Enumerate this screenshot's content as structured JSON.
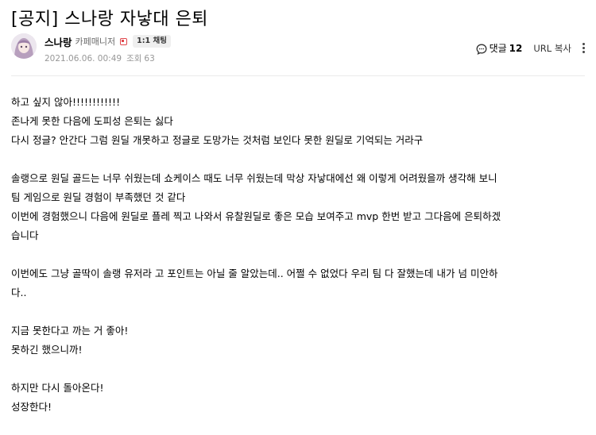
{
  "post": {
    "title": "[공지] 스나랑 자낳대 은퇴",
    "author": {
      "nickname": "스나랑",
      "role": "카페매니저",
      "chat_label": "1:1 채팅"
    },
    "date": "2021.06.06. 00:49",
    "views_label": "조회",
    "views": "63"
  },
  "tools": {
    "comment_label": "댓글",
    "comment_count": "12",
    "url_copy_label": "URL 복사",
    "icons": [
      "comment-icon",
      "more-icon"
    ]
  },
  "body": {
    "lines": [
      "하고 싶지 않아!!!!!!!!!!!!",
      "존나게 못한 다음에 도피성 은퇴는 싫다",
      "다시 정글? 안간다 그럼 원딜 개못하고 정글로 도망가는 것처럼 보인다 못한 원딜로 기억되는 거라구",
      "",
      "솔랭으로 원딜 골드는 너무 쉬웠는데 쇼케이스 때도 너무 쉬웠는데 막상 자낳대에선 왜 이렇게 어려웠을까 생각해 보니",
      "팀 게임으로 원딜 경험이 부족했던 것 같다",
      "이번에 경험했으니 다음에 원딜로 플레 찍고 나와서 유찰원딜로 좋은 모습 보여주고 mvp 한번 받고 그다음에 은퇴하겠",
      "습니다",
      "",
      "이번에도 그냥 골딱이 솔랭 유저라 고 포인트는 아닐 줄 알았는데.. 어쩔 수 없었다 우리 팀 다 잘했는데 내가 넘 미안하",
      "다..",
      "",
      "지금 못한다고 까는 거 좋아!",
      "못하긴 했으니까!",
      "",
      "하지만 다시 돌아온다!",
      "성장한다!"
    ]
  },
  "colors": {
    "meta_text": "#979797",
    "grade_badge": "#e0464b",
    "divider": "#ebebeb"
  }
}
